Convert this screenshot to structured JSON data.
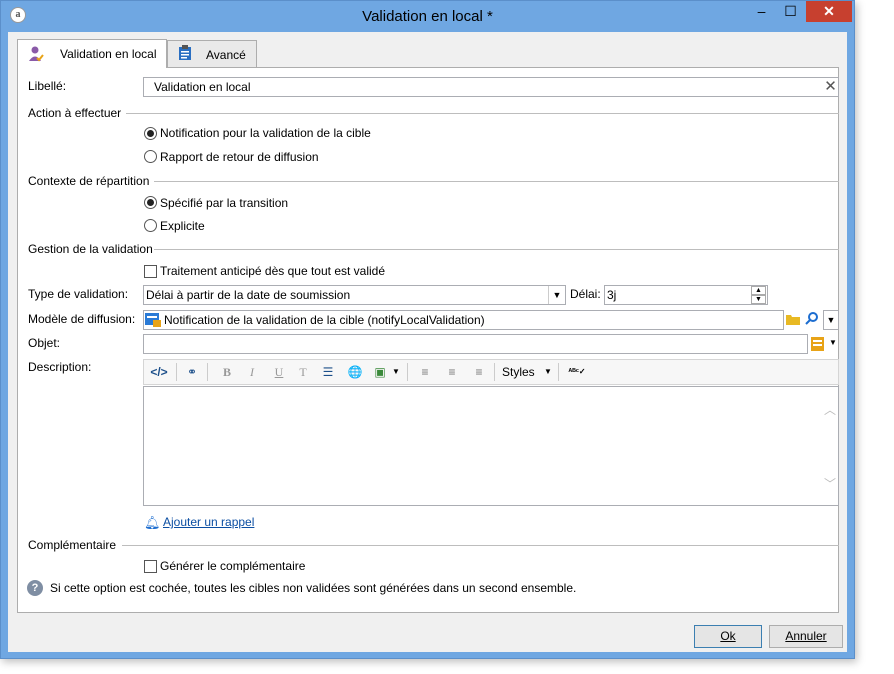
{
  "window": {
    "title": "Validation en local *",
    "minimize": "–",
    "maximize": "☐",
    "close": "✕"
  },
  "tabs": [
    {
      "label": "Validation en local",
      "icon": "user-check-icon",
      "active": true
    },
    {
      "label": "Avancé",
      "icon": "clipboard-icon",
      "active": false
    }
  ],
  "form": {
    "libelle_label": "Libellé:",
    "libelle_value": "Validation en local",
    "action_section": "Action à effectuer",
    "action_options": [
      "Notification pour la validation de la cible",
      "Rapport de retour de diffusion"
    ],
    "action_selected": 0,
    "contexte_section": "Contexte de répartition",
    "contexte_options": [
      "Spécifié par la transition",
      "Explicite"
    ],
    "contexte_selected": 0,
    "gestion_section": "Gestion de la validation",
    "traitement_label": "Traitement anticipé dès que tout est validé",
    "traitement_checked": false,
    "type_label": "Type de validation:",
    "type_value": "Délai à partir de la date de soumission",
    "delai_label": "Délai:",
    "delai_value": "3j",
    "modele_label": "Modèle de diffusion:",
    "modele_value": "Notification de la validation de la cible (notifyLocalValidation)",
    "objet_label": "Objet:",
    "objet_value": "",
    "description_label": "Description:",
    "toolbar": {
      "styles_label": "Styles",
      "bold": "B",
      "italic": "I",
      "underline": "U"
    },
    "description_value": "",
    "rappel_link": "Ajouter un rappel",
    "complementaire_section": "Complémentaire",
    "generer_label": "Générer le complémentaire",
    "generer_checked": false,
    "info_text": "Si cette option est cochée, toutes les cibles non validées sont générées dans un second ensemble."
  },
  "buttons": {
    "ok": "Ok",
    "cancel": "Annuler"
  },
  "colors": {
    "titlebar": "#6fa7e2",
    "close": "#c7402f",
    "link": "#0b4ea2",
    "accent": "#1c6dd0"
  }
}
